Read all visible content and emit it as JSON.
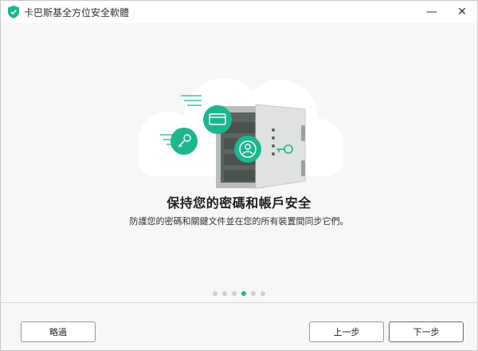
{
  "window": {
    "title": "卡巴斯基全方位安全軟體",
    "minimize_glyph": "—",
    "close_glyph": "✕"
  },
  "colors": {
    "accent": "#1fb58f",
    "cloud": "#ffffff",
    "safe_body": "#b9bdbb",
    "safe_door": "#dfe2e0",
    "safe_inner": "#5b6461"
  },
  "icons": [
    "shield-logo-icon",
    "minimize-icon",
    "close-icon",
    "key-icon",
    "card-icon",
    "user-icon",
    "safe-icon"
  ],
  "main": {
    "heading": "保持您的密碼和帳戶安全",
    "description": "防護您的密碼和關鍵文件並在您的所有裝置間同步它們。",
    "pagination": {
      "total": 6,
      "current": 4
    }
  },
  "footer": {
    "skip_label": "略過",
    "prev_label": "上一步",
    "next_label": "下一步"
  }
}
